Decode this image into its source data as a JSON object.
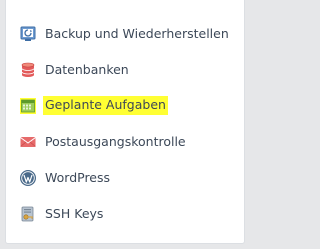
{
  "menu": {
    "items": [
      {
        "label": "Backup und Wiederherstellen",
        "icon": "backup-restore-icon"
      },
      {
        "label": "Datenbanken",
        "icon": "database-icon"
      },
      {
        "label": "Geplante Aufgaben",
        "icon": "calendar-icon",
        "highlighted": true,
        "highlight_color": "#ffff33"
      },
      {
        "label": "Postausgangskontrolle",
        "icon": "envelope-icon"
      },
      {
        "label": "WordPress",
        "icon": "wordpress-icon"
      },
      {
        "label": "SSH Keys",
        "icon": "ssh-key-icon"
      }
    ]
  },
  "colors": {
    "text": "#3c4858",
    "panel_bg": "#ffffff",
    "page_bg": "#e6e7e9",
    "highlight": "#ffff33",
    "database": "#e35a5a",
    "calendar": "#7db740",
    "envelope": "#e66a6a",
    "wordpress": "#4a6a8a"
  }
}
